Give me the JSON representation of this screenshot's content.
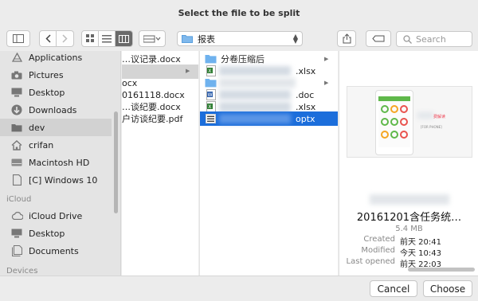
{
  "window": {
    "title": "Select the file to be split"
  },
  "toolbar": {
    "path_label": "报表",
    "search_placeholder": "Search"
  },
  "sidebar": {
    "favorites": [
      {
        "label": "Applications",
        "icon": "applications-icon"
      },
      {
        "label": "Pictures",
        "icon": "camera-icon"
      },
      {
        "label": "Desktop",
        "icon": "desktop-icon"
      },
      {
        "label": "Downloads",
        "icon": "download-icon"
      },
      {
        "label": "dev",
        "icon": "folder-icon",
        "selected": true
      },
      {
        "label": "crifan",
        "icon": "home-icon"
      },
      {
        "label": "Macintosh HD",
        "icon": "harddisk-icon"
      },
      {
        "label": "[C] Windows 10",
        "icon": "document-icon"
      }
    ],
    "icloud_header": "iCloud",
    "icloud": [
      {
        "label": "iCloud Drive",
        "icon": "cloud-icon"
      },
      {
        "label": "Desktop",
        "icon": "desktop-icon"
      },
      {
        "label": "Documents",
        "icon": "document-icon"
      }
    ],
    "devices_header": "Devices"
  },
  "column1": {
    "items": [
      {
        "label": "…议记录.docx"
      },
      {
        "label": ""
      },
      {
        "label": "ocx"
      },
      {
        "label": "0161118.docx"
      },
      {
        "label": "…谈纪要.docx"
      },
      {
        "label": "户访谈纪要.pdf"
      }
    ]
  },
  "column2": {
    "items": [
      {
        "label": "分卷压缩后",
        "icon": "folder-icon"
      },
      {
        "label": ".xlsx",
        "icon": "excel-icon"
      },
      {
        "label": "",
        "icon": "folder-icon"
      },
      {
        "label": ".doc",
        "icon": "word-icon"
      },
      {
        "label": ".xlsx",
        "icon": "excel-icon"
      },
      {
        "label": "optx",
        "icon": "ppt-icon"
      }
    ]
  },
  "preview": {
    "thumb_title": "费解读",
    "thumb_caption": "[FOR PHONE]",
    "filename": "20161201含任务统…",
    "size": "5.4 MB",
    "meta": [
      {
        "key": "Created",
        "value": "前天 20:41"
      },
      {
        "key": "Modified",
        "value": "今天 10:43"
      },
      {
        "key": "Last opened",
        "value": "前天 22:03"
      }
    ]
  },
  "buttons": {
    "cancel": "Cancel",
    "choose": "Choose"
  }
}
